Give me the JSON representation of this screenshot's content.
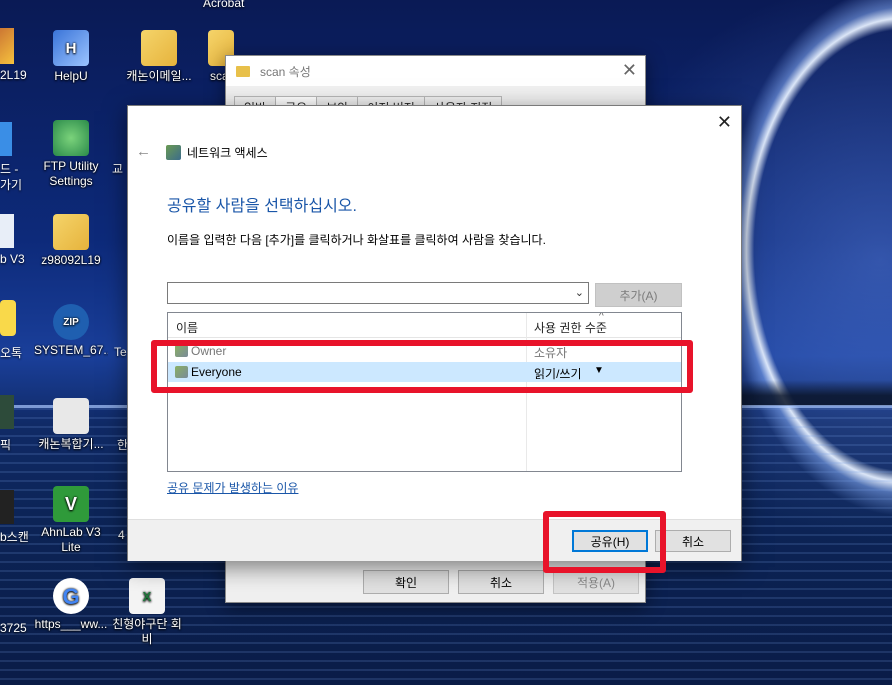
{
  "desktop": {
    "icons": [
      {
        "label": "HelpU",
        "name": "helpu"
      },
      {
        "label": "캐논이메일...",
        "name": "canon-email-folder"
      },
      {
        "label": "sca",
        "name": "scan-folder"
      },
      {
        "label": "FTP Utility Settings",
        "name": "ftp-utility"
      },
      {
        "label": "z98092L19",
        "name": "z98092l19-folder"
      },
      {
        "label": "SYSTEM_67...",
        "name": "system-zip"
      },
      {
        "label": "캐논복합기...",
        "name": "canon-mfp"
      },
      {
        "label": "AhnLab V3 Lite",
        "name": "ahnlab"
      },
      {
        "label": "https___ww...",
        "name": "google-link"
      },
      {
        "label": "친형야구단 회비",
        "name": "excel-file"
      }
    ],
    "partials": [
      "2L19",
      "드 -",
      "가기",
      "교",
      "b V3",
      "Te",
      "오톡",
      "픽",
      "한",
      "b스캔",
      "4",
      "3725",
      "Acrobat"
    ]
  },
  "props_window": {
    "title": "scan 속성",
    "tabs": [
      "일반",
      "공유",
      "보안",
      "이전 버전",
      "사용자 지정"
    ],
    "ok": "확인",
    "cancel": "취소",
    "apply": "적용(A)"
  },
  "dialog": {
    "header": "네트워크 액세스",
    "heading": "공유할 사람을 선택하십시오.",
    "instruction": "이름을 입력한 다음 [추가]를 클릭하거나 화살표를 클릭하여 사람을 찾습니다.",
    "add_button": "추가(A)",
    "columns": {
      "name": "이름",
      "permission": "사용 권한 수준"
    },
    "rows": [
      {
        "name": "Owner",
        "permission": "소유자"
      },
      {
        "name": "Everyone",
        "permission": "읽기/쓰기"
      }
    ],
    "help_link": "공유 문제가 발생하는 이유",
    "share_button": "공유(H)",
    "cancel_button": "취소"
  },
  "colors": {
    "highlight": "#e8132a",
    "link": "#1a56a8",
    "selection": "#cce8ff"
  }
}
